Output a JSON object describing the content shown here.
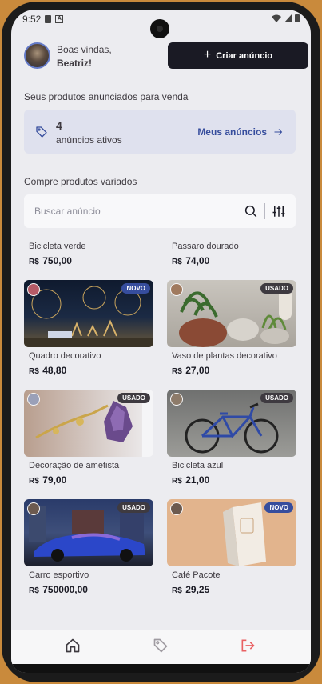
{
  "status_bar": {
    "time": "9:52"
  },
  "header": {
    "greeting": "Boas vindas,",
    "user_name": "Beatriz!",
    "create_button_label": "Criar anúncio"
  },
  "my_ads": {
    "section_title": "Seus produtos anunciados para venda",
    "count": "4",
    "count_label": "anúncios ativos",
    "link_label": "Meus anúncios"
  },
  "browse": {
    "section_title": "Compre produtos variados",
    "search_placeholder": "Buscar anúncio"
  },
  "products": [
    {
      "name": "Bicicleta verde",
      "currency": "R$",
      "price": "750,00"
    },
    {
      "name": "Passaro dourado",
      "currency": "R$",
      "price": "74,00"
    },
    {
      "name": "Quadro decorativo",
      "currency": "R$",
      "price": "48,80",
      "badge": "NOVO"
    },
    {
      "name": "Vaso de plantas decorativo",
      "currency": "R$",
      "price": "27,00",
      "badge": "USADO"
    },
    {
      "name": "Decoração de ametista",
      "currency": "R$",
      "price": "79,00",
      "badge": "USADO"
    },
    {
      "name": "Bicicleta azul",
      "currency": "R$",
      "price": "21,00",
      "badge": "USADO"
    },
    {
      "name": "Carro esportivo",
      "currency": "R$",
      "price": "750000,00",
      "badge": "USADO"
    },
    {
      "name": "Café Pacote",
      "currency": "R$",
      "price": "29,25",
      "badge": "NOVO"
    }
  ],
  "nav": {
    "items": [
      {
        "icon": "home-icon",
        "active": true
      },
      {
        "icon": "tag-icon",
        "active": false
      },
      {
        "icon": "sign-out-icon",
        "active": false,
        "color": "#e96163"
      }
    ]
  },
  "colors": {
    "background": "#ececf0",
    "brand_blue": "#364d9d",
    "dark": "#1a1a24",
    "logout_red": "#e96163"
  }
}
